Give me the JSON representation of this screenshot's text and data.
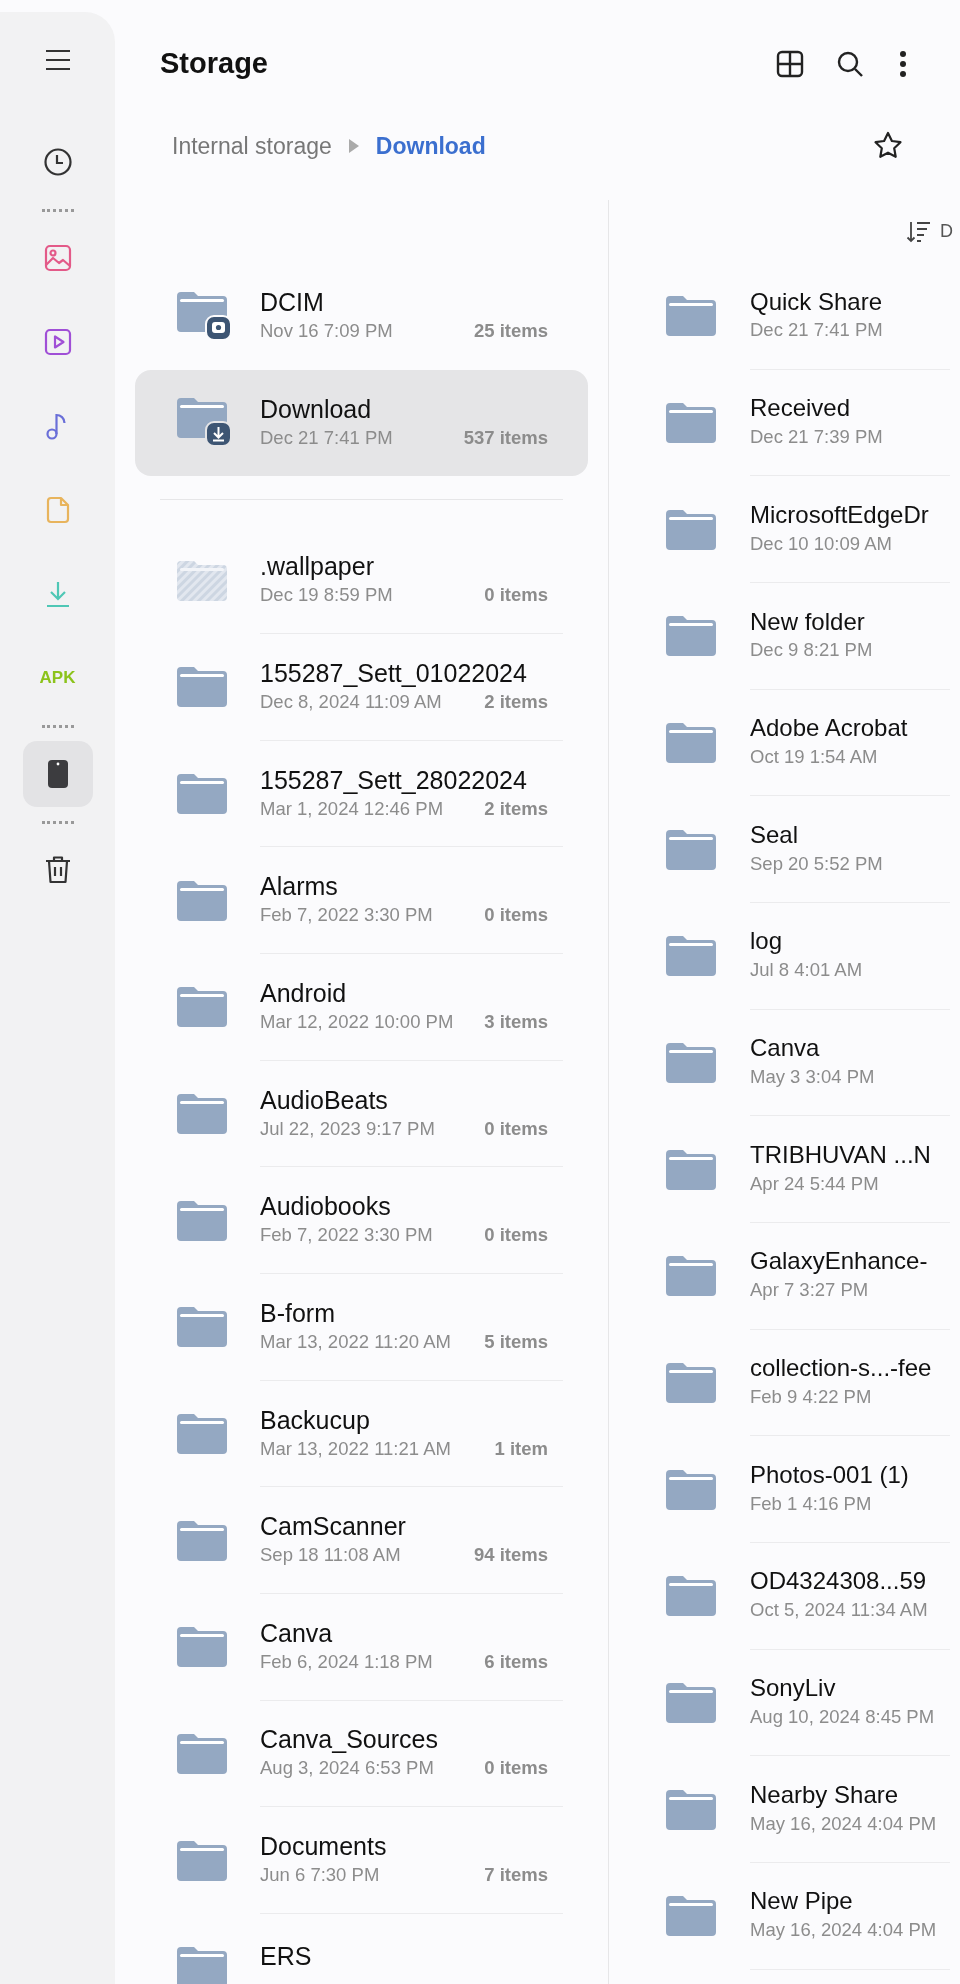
{
  "sidebar": {
    "items": [
      {
        "kind": "recent",
        "selected": false
      },
      {
        "kind": "divider"
      },
      {
        "kind": "images",
        "selected": false
      },
      {
        "kind": "videos",
        "selected": false
      },
      {
        "kind": "audio",
        "selected": false
      },
      {
        "kind": "documents",
        "selected": false
      },
      {
        "kind": "downloads",
        "selected": false
      },
      {
        "kind": "apk",
        "label": "APK",
        "selected": false
      },
      {
        "kind": "divider"
      },
      {
        "kind": "device",
        "selected": true
      },
      {
        "kind": "divider"
      },
      {
        "kind": "trash",
        "selected": false
      }
    ]
  },
  "header": {
    "title": "Storage"
  },
  "breadcrumb": [
    {
      "label": "Internal storage",
      "selected": false
    },
    {
      "label": "Download",
      "selected": true
    }
  ],
  "left_pane": {
    "pinned": [
      {
        "name": "DCIM",
        "date": "Nov 16 7:09 PM",
        "count": "25 items",
        "kind": "camera",
        "selected": false
      },
      {
        "name": "Download",
        "date": "Dec 21 7:41 PM",
        "count": "537 items",
        "kind": "download",
        "selected": true
      }
    ],
    "folders": [
      {
        "name": ".wallpaper",
        "date": "Dec 19 8:59 PM",
        "count": "0 items",
        "hidden": true
      },
      {
        "name": "155287_Sett_01022024",
        "date": "Dec 8, 2024 11:09 AM",
        "count": "2 items",
        "hidden": false
      },
      {
        "name": "155287_Sett_28022024",
        "date": "Mar 1, 2024 12:46 PM",
        "count": "2 items",
        "hidden": false
      },
      {
        "name": "Alarms",
        "date": "Feb 7, 2022 3:30 PM",
        "count": "0 items",
        "hidden": false
      },
      {
        "name": "Android",
        "date": "Mar 12, 2022 10:00 PM",
        "count": "3 items",
        "hidden": false
      },
      {
        "name": "AudioBeats",
        "date": "Jul 22, 2023 9:17 PM",
        "count": "0 items",
        "hidden": false
      },
      {
        "name": "Audiobooks",
        "date": "Feb 7, 2022 3:30 PM",
        "count": "0 items",
        "hidden": false
      },
      {
        "name": "B-form",
        "date": "Mar 13, 2022 11:20 AM",
        "count": "5 items",
        "hidden": false
      },
      {
        "name": "Backucup",
        "date": "Mar 13, 2022 11:21 AM",
        "count": "1 item",
        "hidden": false
      },
      {
        "name": "CamScanner",
        "date": "Sep 18 11:08 AM",
        "count": "94 items",
        "hidden": false
      },
      {
        "name": "Canva",
        "date": "Feb 6, 2024 1:18 PM",
        "count": "6 items",
        "hidden": false
      },
      {
        "name": "Canva_Sources",
        "date": "Aug 3, 2024 6:53 PM",
        "count": "0 items",
        "hidden": false
      },
      {
        "name": "Documents",
        "date": "Jun 6 7:30 PM",
        "count": "7 items",
        "hidden": false
      },
      {
        "name": "ERS",
        "hidden": false
      }
    ]
  },
  "right_pane": {
    "sort_label": "D",
    "folders": [
      {
        "name": "Quick Share",
        "date": "Dec 21 7:41 PM"
      },
      {
        "name": "Received",
        "date": "Dec 21 7:39 PM"
      },
      {
        "name": "MicrosoftEdgeDr",
        "date": "Dec 10 10:09 AM"
      },
      {
        "name": "New folder",
        "date": "Dec 9 8:21 PM"
      },
      {
        "name": "Adobe Acrobat",
        "date": "Oct 19 1:54 AM"
      },
      {
        "name": "Seal",
        "date": "Sep 20 5:52 PM"
      },
      {
        "name": "log",
        "date": "Jul 8 4:01 AM"
      },
      {
        "name": "Canva",
        "date": "May 3 3:04 PM"
      },
      {
        "name": "TRIBHUVAN ...N",
        "date": "Apr 24 5:44 PM"
      },
      {
        "name": "GalaxyEnhance-",
        "date": "Apr 7 3:27 PM"
      },
      {
        "name": "collection-s...-fee",
        "date": "Feb 9 4:22 PM"
      },
      {
        "name": "Photos-001 (1)",
        "date": "Feb 1 4:16 PM"
      },
      {
        "name": "OD4324308...59",
        "date": "Oct 5, 2024 11:34 AM"
      },
      {
        "name": "SonyLiv",
        "date": "Aug 10, 2024 8:45 PM"
      },
      {
        "name": "Nearby Share",
        "date": "May 16, 2024 4:04 PM"
      },
      {
        "name": "New Pipe",
        "date": "May 16, 2024 4:04 PM"
      }
    ]
  }
}
